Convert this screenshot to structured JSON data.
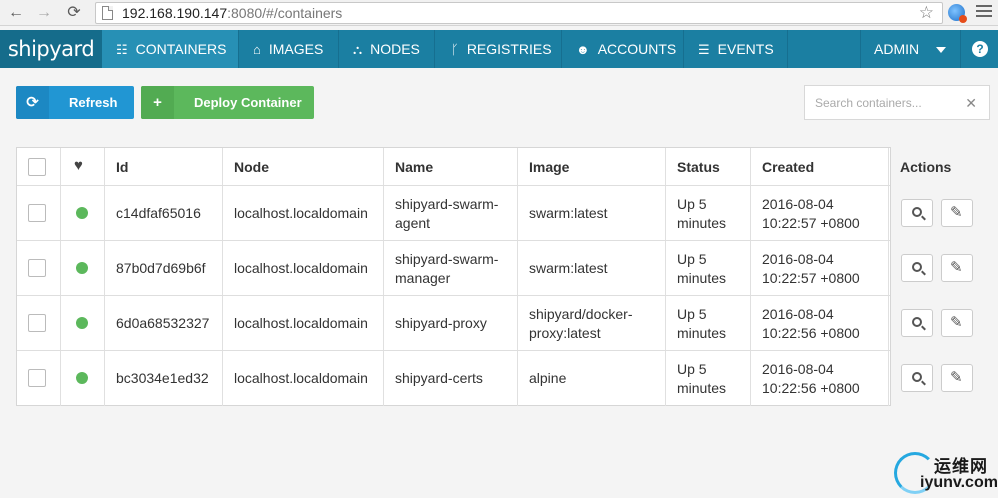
{
  "browser": {
    "url_host": "192.168.190.147",
    "url_rest": ":8080/#/containers",
    "back_glyph": "←",
    "forward_glyph": "→",
    "reload_glyph": "⟳",
    "star_glyph": "☆"
  },
  "app": {
    "brand": "shipyard",
    "nav": [
      {
        "label": "CONTAINERS",
        "icon": "grid-icon",
        "glyph": "☷",
        "active": true
      },
      {
        "label": "IMAGES",
        "icon": "hdd-icon",
        "glyph": "⌂",
        "active": false
      },
      {
        "label": "NODES",
        "icon": "sitemap-icon",
        "glyph": "⛬",
        "active": false
      },
      {
        "label": "REGISTRIES",
        "icon": "branch-icon",
        "glyph": "ᚴ",
        "active": false
      },
      {
        "label": "ACCOUNTS",
        "icon": "user-icon",
        "glyph": "☻",
        "active": false
      },
      {
        "label": "EVENTS",
        "icon": "list-icon",
        "glyph": "☰",
        "active": false
      }
    ],
    "user": "ADMIN",
    "help_glyph": "?"
  },
  "toolbar": {
    "refresh_label": "Refresh",
    "refresh_glyph": "⟳",
    "deploy_label": "Deploy Container",
    "deploy_glyph": "+",
    "search_placeholder": "Search containers...",
    "clear_glyph": "✕"
  },
  "table": {
    "headers": {
      "heartbeat_glyph": "♥",
      "id": "Id",
      "node": "Node",
      "name": "Name",
      "image": "Image",
      "status": "Status",
      "created": "Created",
      "actions": "Actions"
    },
    "rows": [
      {
        "id": "c14dfaf65016",
        "node": "localhost.localdomain",
        "name_1": "shipyard-swarm-",
        "name_2": "agent",
        "image_1": "swarm:latest",
        "image_2": "",
        "status_1": "Up 5",
        "status_2": "minutes",
        "created_1": "2016-08-04",
        "created_2": "10:22:57 +0800",
        "health": "running"
      },
      {
        "id": "87b0d7d69b6f",
        "node": "localhost.localdomain",
        "name_1": "shipyard-swarm-",
        "name_2": "manager",
        "image_1": "swarm:latest",
        "image_2": "",
        "status_1": "Up 5",
        "status_2": "minutes",
        "created_1": "2016-08-04",
        "created_2": "10:22:57 +0800",
        "health": "running"
      },
      {
        "id": "6d0a68532327",
        "node": "localhost.localdomain",
        "name_1": "shipyard-proxy",
        "name_2": "",
        "image_1": "shipyard/docker-",
        "image_2": "proxy:latest",
        "status_1": "Up 5",
        "status_2": "minutes",
        "created_1": "2016-08-04",
        "created_2": "10:22:56 +0800",
        "health": "running"
      },
      {
        "id": "bc3034e1ed32",
        "node": "localhost.localdomain",
        "name_1": "shipyard-certs",
        "name_2": "",
        "image_1": "alpine",
        "image_2": "",
        "status_1": "Up 5",
        "status_2": "minutes",
        "created_1": "2016-08-04",
        "created_2": "10:22:56 +0800",
        "health": "running"
      }
    ],
    "wrench_glyph": "✎"
  },
  "watermark": {
    "cn": "运维网",
    "en": "iyunv.com"
  },
  "colors": {
    "nav_bg": "#1b7fa2",
    "brand_bg": "#156c8b",
    "refresh_btn": "#2196d3",
    "deploy_btn": "#5cb85c",
    "status_running": "#5cb85c"
  }
}
